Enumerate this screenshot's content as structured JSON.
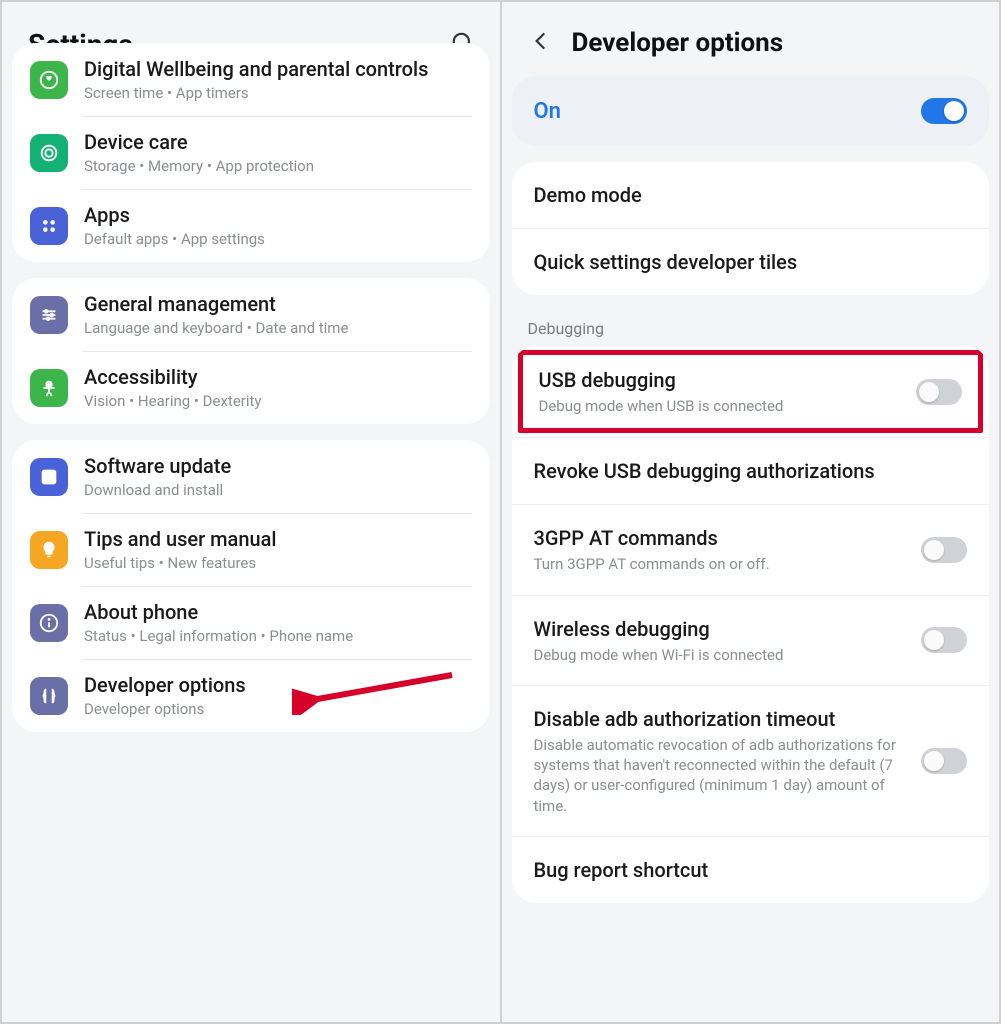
{
  "left": {
    "title": "Settings",
    "groups": [
      {
        "items": [
          {
            "icon": "heart",
            "color": "#3cb64b",
            "title": "Digital Wellbeing and parental controls",
            "sub": "Screen time  •  App timers",
            "truncatedTop": true
          },
          {
            "icon": "target",
            "color": "#14b174",
            "title": "Device care",
            "sub": "Storage  •  Memory  •  App protection"
          },
          {
            "icon": "grid",
            "color": "#4a62d8",
            "title": "Apps",
            "sub": "Default apps  •  App settings"
          }
        ]
      },
      {
        "items": [
          {
            "icon": "sliders",
            "color": "#6b6fa8",
            "title": "General management",
            "sub": "Language and keyboard  •  Date and time"
          },
          {
            "icon": "person",
            "color": "#3cb64b",
            "title": "Accessibility",
            "sub": "Vision  •  Hearing  •  Dexterity"
          }
        ]
      },
      {
        "items": [
          {
            "icon": "download",
            "color": "#4a62d8",
            "title": "Software update",
            "sub": "Download and install"
          },
          {
            "icon": "bulb",
            "color": "#f5a623",
            "title": "Tips and user manual",
            "sub": "Useful tips  •  New features"
          },
          {
            "icon": "info",
            "color": "#6b6fa8",
            "title": "About phone",
            "sub": "Status  •  Legal information  •  Phone name"
          },
          {
            "icon": "braces",
            "color": "#6b6fa8",
            "title": "Developer options",
            "sub": "Developer options",
            "arrow": true
          }
        ]
      }
    ]
  },
  "right": {
    "title": "Developer options",
    "master": {
      "label": "On",
      "on": true
    },
    "section1": [
      {
        "title": "Demo mode"
      },
      {
        "title": "Quick settings developer tiles"
      }
    ],
    "debugHeader": "Debugging",
    "debugItems": [
      {
        "title": "USB debugging",
        "sub": "Debug mode when USB is connected",
        "toggle": "off",
        "highlight": true
      },
      {
        "title": "Revoke USB debugging authorizations"
      },
      {
        "title": "3GPP AT commands",
        "sub": "Turn 3GPP AT commands on or off.",
        "toggle": "off"
      },
      {
        "title": "Wireless debugging",
        "sub": "Debug mode when Wi-Fi is connected",
        "toggle": "off"
      },
      {
        "title": "Disable adb authorization timeout",
        "sub": "Disable automatic revocation of adb authorizations for systems that haven't reconnected within the default (7 days) or user-configured (minimum 1 day) amount of time.",
        "toggle": "off"
      },
      {
        "title": "Bug report shortcut"
      }
    ]
  }
}
